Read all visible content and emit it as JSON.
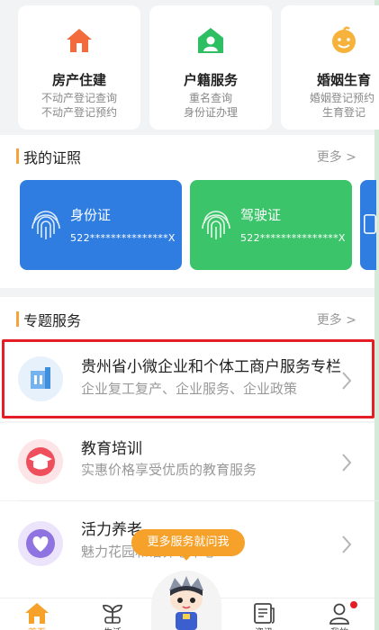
{
  "service_cards": [
    {
      "title": "房产住建",
      "sub1": "不动产登记查询",
      "sub2": "不动产登记预约",
      "icon": "house-icon",
      "color": "#f36b3c"
    },
    {
      "title": "户籍服务",
      "sub1": "重名查询",
      "sub2": "身份证办理",
      "icon": "person-id-icon",
      "color": "#2fbf63"
    },
    {
      "title": "婚姻生育",
      "sub1": "婚姻登记预约",
      "sub2": "生育登记",
      "icon": "baby-face-icon",
      "color": "#f6b23a"
    }
  ],
  "licences": {
    "title": "我的证照",
    "more": "更多 >",
    "cards": [
      {
        "name": "身份证",
        "number": "522***************X",
        "color": "#2f7de1"
      },
      {
        "name": "驾驶证",
        "number": "522***************X",
        "color": "#3cc46a"
      }
    ]
  },
  "topics": {
    "title": "专题服务",
    "more": "更多 >",
    "items": [
      {
        "title": "贵州省小微企业和个体工商户服务专栏",
        "desc": "企业复工复产、企业服务、企业政策",
        "icon": "building-icon",
        "color": "#5fa8ec"
      },
      {
        "title": "教育培训",
        "desc": "实惠价格享受优质的教育服务",
        "icon": "graduation-cap-icon",
        "color": "#ef4f5c"
      },
      {
        "title": "活力养老",
        "desc": "魅力花园和谐养老中心",
        "icon": "heart-hands-icon",
        "color": "#8f73e0"
      }
    ]
  },
  "assistant": {
    "bubble": "更多服务就问我"
  },
  "tabbar": {
    "tabs": [
      {
        "label": "首页",
        "icon": "home-icon"
      },
      {
        "label": "生活",
        "icon": "sprout-icon"
      },
      {
        "label": "资讯",
        "icon": "news-icon"
      },
      {
        "label": "我的",
        "icon": "user-icon"
      }
    ],
    "active_color": "#f6a12a"
  }
}
